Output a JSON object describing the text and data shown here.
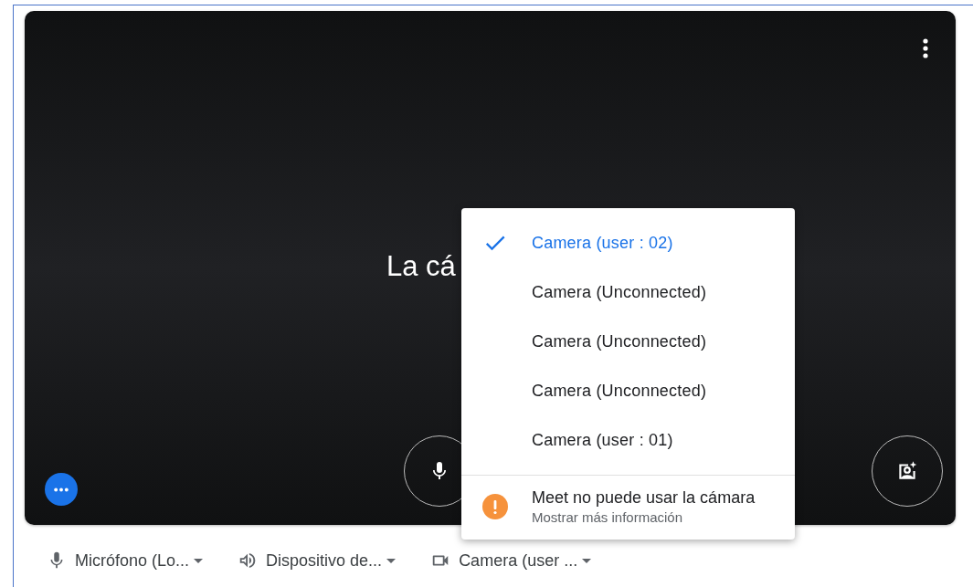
{
  "preview": {
    "message": "La cá"
  },
  "camera_menu": {
    "options": [
      {
        "label": "Camera (user : 02)",
        "selected": true
      },
      {
        "label": "Camera (Unconnected)",
        "selected": false
      },
      {
        "label": "Camera (Unconnected)",
        "selected": false
      },
      {
        "label": "Camera (Unconnected)",
        "selected": false
      },
      {
        "label": "Camera (user : 01)",
        "selected": false
      }
    ],
    "warning": {
      "title": "Meet no puede usar la cámara",
      "detail": "Mostrar más información"
    }
  },
  "device_bar": [
    {
      "kind": "microphone",
      "label": "Micrófono (Lo..."
    },
    {
      "kind": "speaker",
      "label": "Dispositivo de..."
    },
    {
      "kind": "camera",
      "label": "Camera (user ..."
    }
  ]
}
